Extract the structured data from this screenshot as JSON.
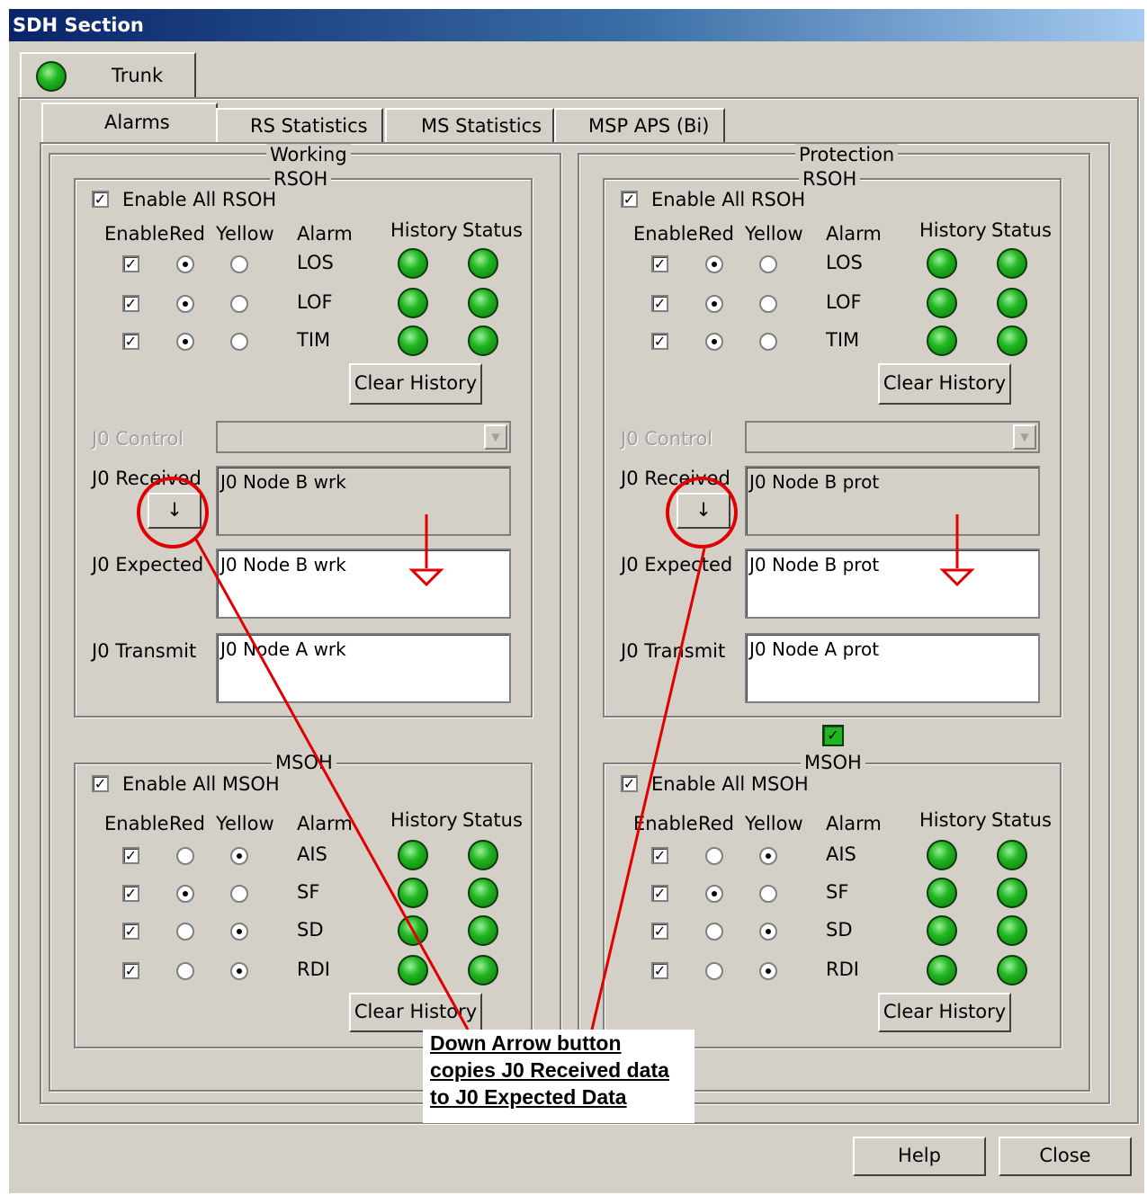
{
  "window": {
    "title": "SDH Section"
  },
  "top_tab": {
    "label": "Trunk"
  },
  "tabs": [
    "Alarms",
    "RS Statistics",
    "MS Statistics",
    "MSP APS (Bi)"
  ],
  "panels": [
    {
      "title": "Working",
      "rsoh": {
        "title": "RSOH",
        "enable_all_label": "Enable All RSOH",
        "headers": {
          "enable": "Enable",
          "red": "Red",
          "yellow": "Yellow",
          "alarm": "Alarm",
          "history": "History",
          "status": "Status"
        },
        "rows": [
          {
            "alarm": "LOS",
            "enabled": true,
            "severity": "red"
          },
          {
            "alarm": "LOF",
            "enabled": true,
            "severity": "red"
          },
          {
            "alarm": "TIM",
            "enabled": true,
            "severity": "red"
          }
        ],
        "clear_history_label": "Clear History"
      },
      "j0": {
        "control_label": "J0 Control",
        "control_value": "",
        "received_label": "J0 Received",
        "received_value": "J0 Node B wrk",
        "copy_button_glyph": "↓",
        "expected_label": "J0 Expected",
        "expected_value": "J0 Node B wrk",
        "transmit_label": "J0 Transmit",
        "transmit_value": "J0 Node A wrk"
      },
      "msoh": {
        "title": "MSOH",
        "enable_all_label": "Enable All MSOH",
        "headers": {
          "enable": "Enable",
          "red": "Red",
          "yellow": "Yellow",
          "alarm": "Alarm",
          "history": "History",
          "status": "Status"
        },
        "rows": [
          {
            "alarm": "AIS",
            "enabled": true,
            "severity": "yellow"
          },
          {
            "alarm": "SF",
            "enabled": true,
            "severity": "red"
          },
          {
            "alarm": "SD",
            "enabled": true,
            "severity": "yellow"
          },
          {
            "alarm": "RDI",
            "enabled": true,
            "severity": "yellow"
          }
        ],
        "clear_history_label": "Clear History"
      }
    },
    {
      "title": "Protection",
      "rsoh": {
        "title": "RSOH",
        "enable_all_label": "Enable All RSOH",
        "headers": {
          "enable": "Enable",
          "red": "Red",
          "yellow": "Yellow",
          "alarm": "Alarm",
          "history": "History",
          "status": "Status"
        },
        "rows": [
          {
            "alarm": "LOS",
            "enabled": true,
            "severity": "red"
          },
          {
            "alarm": "LOF",
            "enabled": true,
            "severity": "red"
          },
          {
            "alarm": "TIM",
            "enabled": true,
            "severity": "red"
          }
        ],
        "clear_history_label": "Clear History"
      },
      "j0": {
        "control_label": "J0 Control",
        "control_value": "",
        "received_label": "J0 Received",
        "received_value": "J0 Node B prot",
        "copy_button_glyph": "↓",
        "expected_label": "J0 Expected",
        "expected_value": "J0 Node B prot",
        "transmit_label": "J0 Transmit",
        "transmit_value": "J0 Node A prot"
      },
      "msoh": {
        "title": "MSOH",
        "enable_all_label": "Enable All MSOH",
        "headers": {
          "enable": "Enable",
          "red": "Red",
          "yellow": "Yellow",
          "alarm": "Alarm",
          "history": "History",
          "status": "Status"
        },
        "rows": [
          {
            "alarm": "AIS",
            "enabled": true,
            "severity": "yellow"
          },
          {
            "alarm": "SF",
            "enabled": true,
            "severity": "red"
          },
          {
            "alarm": "SD",
            "enabled": true,
            "severity": "yellow"
          },
          {
            "alarm": "RDI",
            "enabled": true,
            "severity": "yellow"
          }
        ],
        "clear_history_label": "Clear History"
      }
    }
  ],
  "footer": {
    "help_label": "Help",
    "close_label": "Close"
  },
  "annotation": {
    "lines": [
      "Down Arrow button",
      "copies J0 Received data",
      "to J0 Expected Data"
    ]
  },
  "colors": {
    "titlebar": "#0a246a",
    "led_ok": "#22b522",
    "face": "#d4d0c8",
    "annotation": "#e00000"
  }
}
